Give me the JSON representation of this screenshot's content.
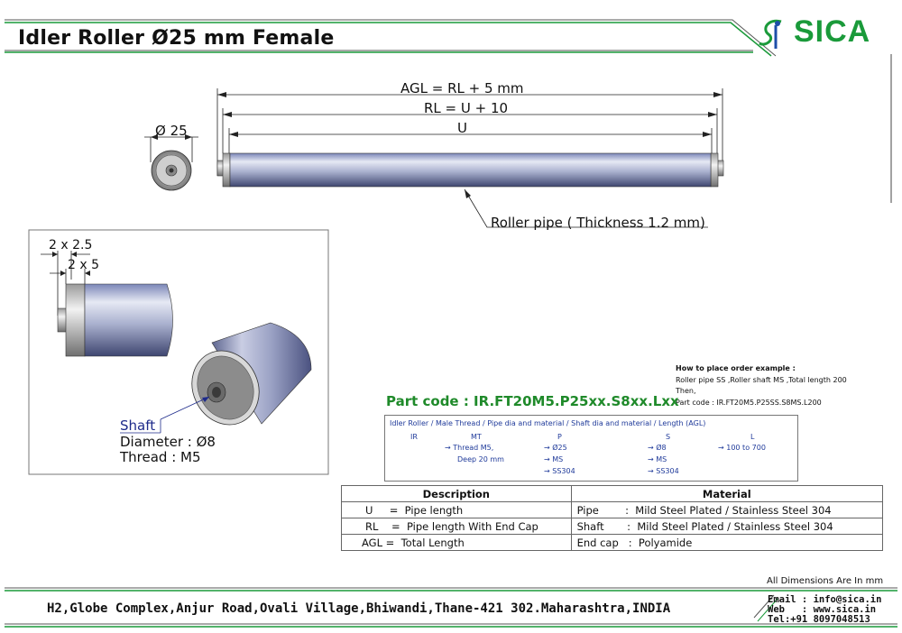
{
  "title": "Idler Roller Ø25 mm Female",
  "brand": {
    "name": "SICA",
    "color": "#1a9a3a"
  },
  "dimensions": {
    "agl": "AGL = RL + 5 mm",
    "rl": "RL = U + 10",
    "u": "U",
    "diameter": "Ø 25",
    "pipe_note": "Roller pipe ( Thickness 1.2 mm)",
    "chamfer1": "2 x 2.5",
    "chamfer2": "2 x 5"
  },
  "shaft": {
    "label": "Shaft",
    "diameter": "Diameter : Ø8",
    "thread": "Thread : M5"
  },
  "part_code": "Part code : IR.FT20M5.P25xx.S8xx.Lxx",
  "order_example": {
    "heading": "How to place order example :",
    "line1": "Roller pipe SS ,Roller shaft MS ,Total length 200",
    "line2": "Then,",
    "line3": "Part code : IR.FT20M5.P25SS.S8MS.L200"
  },
  "code_legend": {
    "header": "Idler Roller / Male Thread / Pipe dia and material / Shaft dia and material / Length (AGL)",
    "codes": [
      "IR",
      "MT",
      "P",
      "S",
      "L"
    ],
    "thread1": "→ Thread M5,",
    "thread2": "Deep 20 mm",
    "pipe": [
      "→ Ø25",
      "→ MS",
      "→ SS304"
    ],
    "shaft": [
      "→  Ø8",
      "→  MS",
      "→ SS304"
    ],
    "length": "→ 100 to 700"
  },
  "table": {
    "headers": [
      "Description",
      "Material"
    ],
    "rows": [
      {
        "desc": "U     =  Pipe length",
        "mat": "Pipe        :  Mild Steel Plated / Stainless Steel 304"
      },
      {
        "desc": "RL    =  Pipe length With End Cap",
        "mat": "Shaft       :  Mild Steel Plated / Stainless Steel 304"
      },
      {
        "desc": "AGL =  Total Length",
        "mat": "End cap   :  Polyamide"
      }
    ]
  },
  "all_dimensions": "All Dimensions Are In mm",
  "footer": {
    "address": "H2,Globe Complex,Anjur Road,Ovali Village,Bhiwandi,Thane-421 302.Maharashtra,INDIA",
    "email": "Email : info@sica.in",
    "web": "Web   : www.sica.in",
    "tel": "Tel:+91 8097048513"
  }
}
